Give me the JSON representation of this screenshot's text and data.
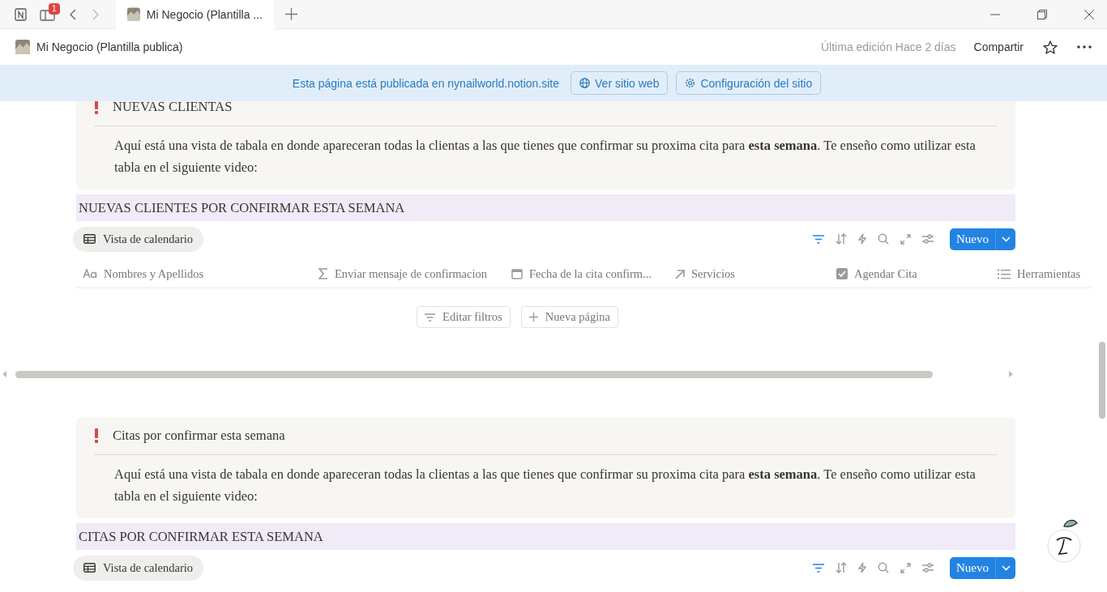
{
  "browser": {
    "notification_count": "1",
    "tabs": [
      {
        "title": "Mi Negocio (Plantilla ...",
        "selected": true
      }
    ]
  },
  "header": {
    "breadcrumb": "Mi Negocio (Plantilla publica)",
    "last_edited": "Última edición Hace 2 días",
    "share": "Compartir"
  },
  "banner": {
    "message": "Esta página está publicada en nynailworld.notion.site",
    "buttons": [
      {
        "label": "Ver sitio web",
        "kind": "globe"
      },
      {
        "label": "Configuración del sitio",
        "kind": "gear"
      }
    ]
  },
  "sections": [
    {
      "callout": {
        "title": "NUEVAS CLIENTAS",
        "text": "Aquí está una vista de tabala en donde apareceran todas la clientas a las que tienes que confirmar su proxima cita para **esta semana**. Te enseño como utilizar esta tabla en el siguiente video:"
      },
      "heading": "NUEVAS CLIENTES POR CONFIRMAR ESTA SEMANA",
      "view": "Vista de calendario",
      "filter_active": true,
      "new_button": "Nuevo",
      "columns": [
        {
          "label": "Nombres y Apellidos",
          "kind": "title"
        },
        {
          "label": "Enviar mensaje de confirmacion",
          "kind": "formula"
        },
        {
          "label": "Fecha de la cita confirm...",
          "kind": "date"
        },
        {
          "label": "Servicios",
          "kind": "relation"
        },
        {
          "label": "Agendar Cita",
          "kind": "checkbox"
        },
        {
          "label": "Herramientas",
          "kind": "list"
        }
      ],
      "empty_actions": [
        {
          "label": "Editar filtros",
          "kind": "filter"
        },
        {
          "label": "Nueva página",
          "kind": "plus"
        }
      ]
    },
    {
      "callout": {
        "title": "Citas por confirmar esta semana",
        "text": "Aquí está una vista de tabala en donde apareceran todas la clientas a las que tienes que confirmar su proxima cita para **esta semana**. Te enseño como utilizar esta tabla en el siguiente video:"
      },
      "heading": "CITAS POR CONFIRMAR ESTA SEMANA",
      "view": "Vista de calendario",
      "filter_active": true,
      "new_button": "Nuevo"
    }
  ]
}
